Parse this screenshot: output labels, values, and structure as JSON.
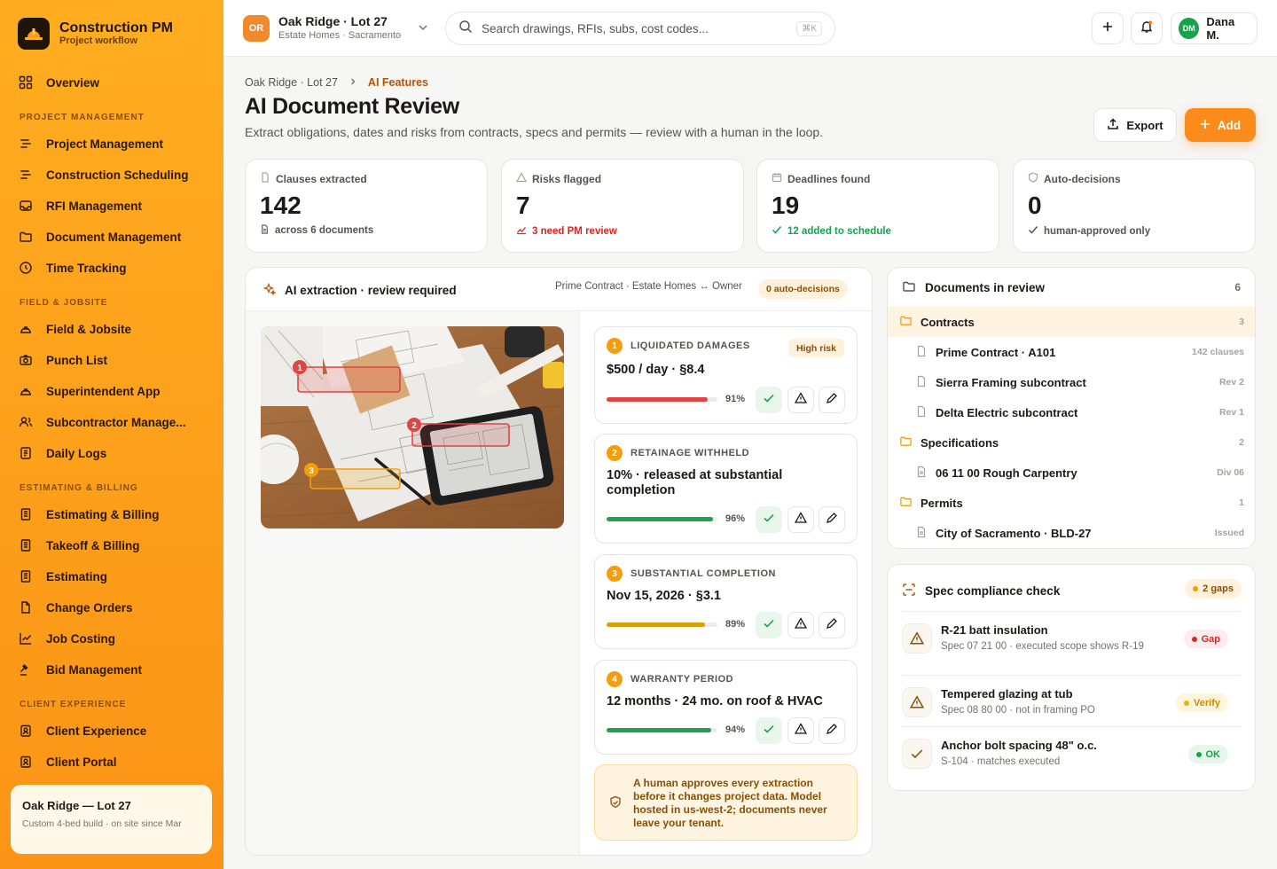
{
  "app": {
    "title": "Construction PM",
    "subtitle": "Project workflow"
  },
  "sidebar": {
    "overview": "Overview",
    "sections": [
      {
        "label": "PROJECT MANAGEMENT"
      },
      {
        "label": "FIELD & JOBSITE"
      },
      {
        "label": "ESTIMATING & BILLING"
      },
      {
        "label": "CLIENT EXPERIENCE"
      }
    ],
    "items": [
      {
        "label": "Project Management",
        "icon": "list-icon"
      },
      {
        "label": "Construction Scheduling",
        "icon": "list-icon"
      },
      {
        "label": "RFI Management",
        "icon": "inbox-icon"
      },
      {
        "label": "Document Management",
        "icon": "folder-icon"
      },
      {
        "label": "Time Tracking",
        "icon": "clock-icon"
      },
      {
        "label": "Field & Jobsite",
        "icon": "hardhat-icon"
      },
      {
        "label": "Punch List",
        "icon": "camera-icon"
      },
      {
        "label": "Superintendent App",
        "icon": "hardhat-icon"
      },
      {
        "label": "Subcontractor Manage...",
        "icon": "users-icon"
      },
      {
        "label": "Daily Logs",
        "icon": "notebook-icon"
      },
      {
        "label": "Estimating & Billing",
        "icon": "receipt-icon"
      },
      {
        "label": "Takeoff & Billing",
        "icon": "receipt-icon"
      },
      {
        "label": "Estimating",
        "icon": "receipt-icon"
      },
      {
        "label": "Change Orders",
        "icon": "file-icon"
      },
      {
        "label": "Job Costing",
        "icon": "chart-icon"
      },
      {
        "label": "Bid Management",
        "icon": "gavel-icon"
      },
      {
        "label": "Client Experience",
        "icon": "building-icon"
      },
      {
        "label": "Client Portal",
        "icon": "building-icon"
      }
    ],
    "project_card": {
      "title": "Oak Ridge — Lot 27",
      "subtitle": "Custom 4-bed build · on site since Mar"
    }
  },
  "topbar": {
    "project_initials": "OR",
    "project_name": "Oak Ridge · Lot 27",
    "project_sub": "Estate Homes · Sacramento",
    "search_placeholder": "Search drawings, RFIs, subs, cost codes...",
    "search_shortcut": "⌘K",
    "user_initials": "DM",
    "user_name": "Dana M."
  },
  "breadcrumb": {
    "parent": "Oak Ridge · Lot 27",
    "current": "AI Features"
  },
  "page": {
    "title": "AI Document Review",
    "description": "Extract obligations, dates and risks from contracts, specs and permits — review with a human in the loop.",
    "export_label": "Export",
    "add_label": "Add"
  },
  "stats": [
    {
      "label": "Clauses extracted",
      "value": "142",
      "sub": "across 6 documents",
      "color": "#57534e"
    },
    {
      "label": "Risks flagged",
      "value": "7",
      "sub": "3 need PM review",
      "color": "#dc2626"
    },
    {
      "label": "Deadlines found",
      "value": "19",
      "sub": "12 added to schedule",
      "color": "#16a34a"
    },
    {
      "label": "Auto-decisions",
      "value": "0",
      "sub": "human-approved only",
      "color": "#57534e"
    }
  ],
  "ai_panel": {
    "title": "AI extraction · review required",
    "meta": "Prime Contract · Estate Homes ↔ Owner",
    "badge": "0 auto-decisions",
    "photo_markers": [
      "1",
      "2",
      "3"
    ],
    "extractions": [
      {
        "n": "1",
        "title": "LIQUIDATED DAMAGES",
        "value": "$500 / day · §8.4",
        "confidence": 91,
        "pct": "91%",
        "color": "#e04444",
        "risk": "High risk"
      },
      {
        "n": "2",
        "title": "RETAINAGE WITHHELD",
        "value": "10% · released at substantial completion",
        "confidence": 96,
        "pct": "96%",
        "color": "#22a04b"
      },
      {
        "n": "3",
        "title": "SUBSTANTIAL COMPLETION",
        "value": "Nov 15, 2026 · §3.1",
        "confidence": 89,
        "pct": "89%",
        "color": "#d4a20a"
      },
      {
        "n": "4",
        "title": "WARRANTY PERIOD",
        "value": "12 months · 24 mo. on roof & HVAC",
        "confidence": 94,
        "pct": "94%",
        "color": "#22a04b"
      }
    ],
    "note": "A human approves every extraction before it changes project data. Model hosted in us-west-2; documents never leave your tenant."
  },
  "documents": {
    "title": "Documents in review",
    "count": "6",
    "groups": [
      {
        "name": "Contracts",
        "count": "3",
        "docs": [
          {
            "name": "Prime Contract · A101",
            "meta": "142 clauses"
          },
          {
            "name": "Sierra Framing subcontract",
            "meta": "Rev 2"
          },
          {
            "name": "Delta Electric subcontract",
            "meta": "Rev 1"
          }
        ]
      },
      {
        "name": "Specifications",
        "count": "2",
        "docs": [
          {
            "name": "06 11 00 Rough Carpentry",
            "meta": "Div 06"
          }
        ]
      },
      {
        "name": "Permits",
        "count": "1",
        "docs": [
          {
            "name": "City of Sacramento · BLD-27",
            "meta": "Issued"
          }
        ]
      }
    ]
  },
  "spec": {
    "title": "Spec compliance check",
    "badge": "2 gaps",
    "rows": [
      {
        "title": "R-21 batt insulation",
        "sub": "Spec 07 21 00 · executed scope shows R-19",
        "status": "Gap",
        "bg": "#fdecec",
        "fg": "#dc2626"
      },
      {
        "title": "Tempered glazing at tub",
        "sub": "Spec 08 80 00 · not in framing PO",
        "status": "Verify",
        "bg": "#fff4dc",
        "fg": "#ca8a04"
      },
      {
        "title": "Anchor bolt spacing 48\" o.c.",
        "sub": "S-104 · matches executed",
        "status": "OK",
        "bg": "#e6f6ea",
        "fg": "#16a34a"
      }
    ]
  }
}
